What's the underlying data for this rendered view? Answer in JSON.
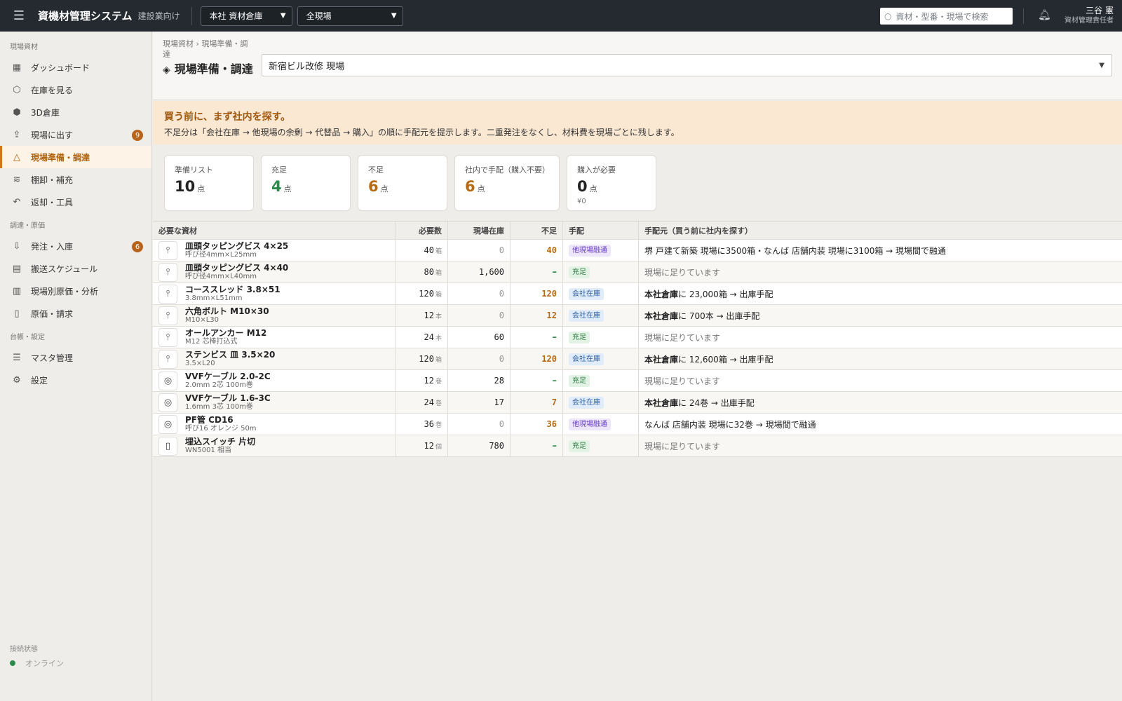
{
  "header": {
    "app_title": "資機材管理システム",
    "app_sub": "建設業向け",
    "warehouse_select": "本社 資材倉庫",
    "site_filter_select": "全現場",
    "search_placeholder": "資材・型番・現場で検索",
    "user_name": "三谷 憲",
    "user_role": "資材管理責任者"
  },
  "sidebar": {
    "sections": [
      {
        "label": "現場資材",
        "items": [
          {
            "label": "ダッシュボード",
            "icon": "dashboard-icon"
          },
          {
            "label": "在庫を見る",
            "icon": "box-icon"
          },
          {
            "label": "3D倉庫",
            "icon": "cube-icon"
          },
          {
            "label": "現場に出す",
            "icon": "upload-icon",
            "badge": "9"
          },
          {
            "label": "現場準備・調達",
            "icon": "site-icon",
            "active": true
          },
          {
            "label": "棚卸・補充",
            "icon": "layers-icon"
          },
          {
            "label": "返却・工具",
            "icon": "return-icon"
          }
        ]
      },
      {
        "label": "調達・原価",
        "items": [
          {
            "label": "発注・入庫",
            "icon": "download-icon",
            "badge": "6"
          },
          {
            "label": "搬送スケジュール",
            "icon": "calendar-icon"
          },
          {
            "label": "現場別原価・分析",
            "icon": "chart-icon"
          },
          {
            "label": "原価・請求",
            "icon": "document-icon"
          }
        ]
      },
      {
        "label": "台帳・設定",
        "items": [
          {
            "label": "マスタ管理",
            "icon": "database-icon"
          },
          {
            "label": "設定",
            "icon": "gear-icon"
          }
        ]
      }
    ],
    "connection_label": "接続状態",
    "connection_status": "オンライン"
  },
  "page": {
    "breadcrumb": "現場資材 › 現場準備・調達",
    "title": "現場準備・調達",
    "site_select": "新宿ビル改修 現場"
  },
  "banner": {
    "heading": "買う前に、まず社内を探す。",
    "text": "不足分は「会社在庫 → 他現場の余剰 → 代替品 → 購入」の順に手配元を提示します。二重発注をなくし、材料費を現場ごとに残します。"
  },
  "summary": {
    "prep_list": {
      "label": "準備リスト",
      "value": "10",
      "unit": "点"
    },
    "sufficient": {
      "label": "充足",
      "value": "4",
      "unit": "点"
    },
    "shortage": {
      "label": "不足",
      "value": "6",
      "unit": "点"
    },
    "internal": {
      "label": "社内で手配（購入不要）",
      "value": "6",
      "unit": "点"
    },
    "purchase": {
      "label": "購入が必要",
      "value": "0",
      "unit": "点",
      "amount": "¥0"
    }
  },
  "colors": {
    "accent": "#c9781d",
    "ok": "#2c8a4a",
    "dark": "#252a30"
  },
  "table": {
    "headers": {
      "material": "必要な資材",
      "required": "必要数",
      "onsite": "現場在庫",
      "shortage": "不足",
      "arrangement": "手配",
      "source": "手配元（買う前に社内を探す）"
    },
    "rows": [
      {
        "icon": "screw-icon",
        "name": "皿頭タッピングビス 4×25",
        "spec": "呼び径4mm×L25mm",
        "required": "40",
        "unit": "箱",
        "onsite": "0",
        "shortage": "40",
        "tag": "他現場融通",
        "tag_type": "other",
        "source_bold": "",
        "source": "堺 戸建て新築 現場に3500箱・なんば 店舗内装 現場に3100箱 → 現場間で融通"
      },
      {
        "icon": "screw-icon",
        "name": "皿頭タッピングビス 4×40",
        "spec": "呼び径4mm×L40mm",
        "required": "80",
        "unit": "箱",
        "onsite": "1,600",
        "shortage": "–",
        "tag": "充足",
        "tag_type": "ok",
        "source_bold": "",
        "source": "現場に足りています"
      },
      {
        "icon": "screw-icon",
        "name": "コーススレッド 3.8×51",
        "spec": "3.8mm×L51mm",
        "required": "120",
        "unit": "箱",
        "onsite": "0",
        "shortage": "120",
        "tag": "会社在庫",
        "tag_type": "comp",
        "source_bold": "本社倉庫",
        "source": "に 23,000箱 → 出庫手配"
      },
      {
        "icon": "screw-icon",
        "name": "六角ボルト M10×30",
        "spec": "M10×L30",
        "required": "12",
        "unit": "本",
        "onsite": "0",
        "shortage": "12",
        "tag": "会社在庫",
        "tag_type": "comp",
        "source_bold": "本社倉庫",
        "source": "に 700本 → 出庫手配"
      },
      {
        "icon": "screw-icon",
        "name": "オールアンカー M12",
        "spec": "M12 芯棒打込式",
        "required": "24",
        "unit": "本",
        "onsite": "60",
        "shortage": "–",
        "tag": "充足",
        "tag_type": "ok",
        "source_bold": "",
        "source": "現場に足りています"
      },
      {
        "icon": "screw-icon",
        "name": "ステンビス 皿 3.5×20",
        "spec": "3.5×L20",
        "required": "120",
        "unit": "箱",
        "onsite": "0",
        "shortage": "120",
        "tag": "会社在庫",
        "tag_type": "comp",
        "source_bold": "本社倉庫",
        "source": "に 12,600箱 → 出庫手配"
      },
      {
        "icon": "cable-icon",
        "name": "VVFケーブル 2.0-2C",
        "spec": "2.0mm 2芯 100m巻",
        "required": "12",
        "unit": "巻",
        "onsite": "28",
        "shortage": "–",
        "tag": "充足",
        "tag_type": "ok",
        "source_bold": "",
        "source": "現場に足りています"
      },
      {
        "icon": "cable-icon",
        "name": "VVFケーブル 1.6-3C",
        "spec": "1.6mm 3芯 100m巻",
        "required": "24",
        "unit": "巻",
        "onsite": "17",
        "shortage": "7",
        "tag": "会社在庫",
        "tag_type": "comp",
        "source_bold": "本社倉庫",
        "source": "に 24巻 → 出庫手配"
      },
      {
        "icon": "cable-icon",
        "name": "PF管 CD16",
        "spec": "呼び16 オレンジ 50m",
        "required": "36",
        "unit": "巻",
        "onsite": "0",
        "shortage": "36",
        "tag": "他現場融通",
        "tag_type": "other",
        "source_bold": "",
        "source": "なんば 店舗内装 現場に32巻 → 現場間で融通"
      },
      {
        "icon": "switch-icon",
        "name": "埋込スイッチ 片切",
        "spec": "WN5001 相当",
        "required": "12",
        "unit": "個",
        "onsite": "780",
        "shortage": "–",
        "tag": "充足",
        "tag_type": "ok",
        "source_bold": "",
        "source": "現場に足りています"
      }
    ]
  }
}
